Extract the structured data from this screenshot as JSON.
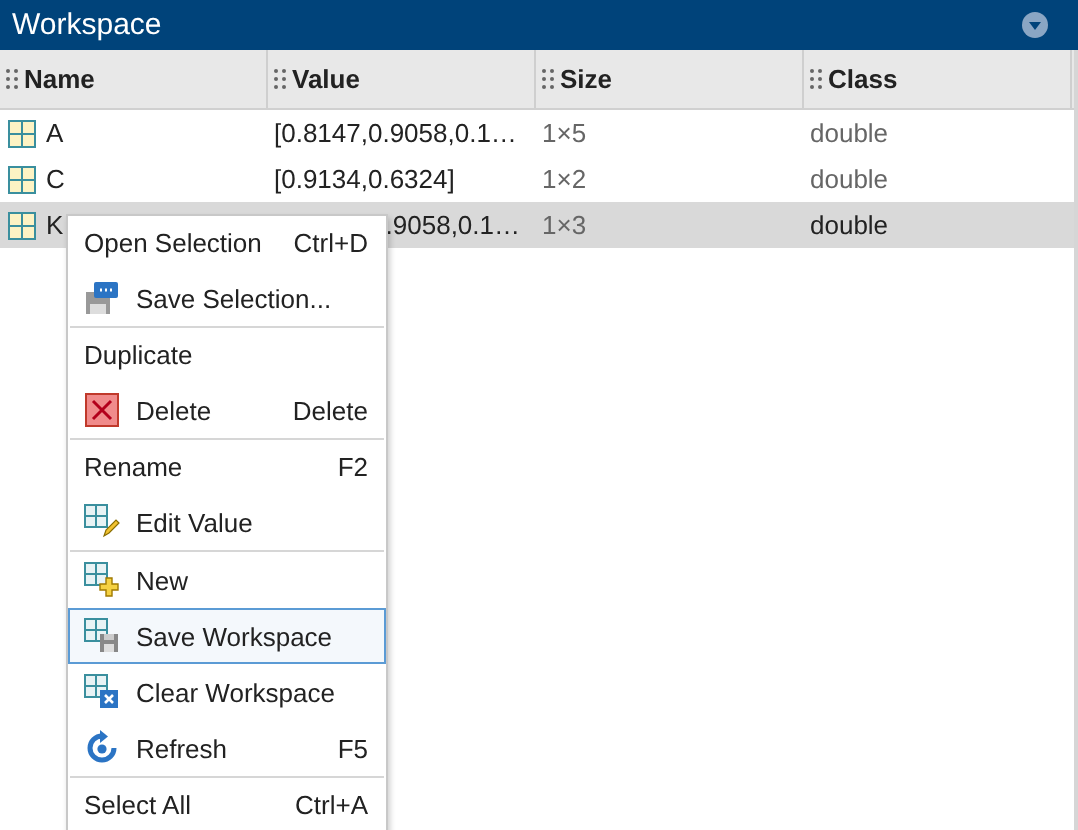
{
  "panel": {
    "title": "Workspace"
  },
  "table": {
    "columns": [
      "Name",
      "Value",
      "Size",
      "Class"
    ],
    "rows": [
      {
        "name": "A",
        "value": "[0.8147,0.9058,0.1…",
        "value_covered": false,
        "size": "1×5",
        "class": "double",
        "selected": false
      },
      {
        "name": "C",
        "value": "[0.9134,0.6324]",
        "value_covered": false,
        "size": "1×2",
        "class": "double",
        "selected": false
      },
      {
        "name": "K",
        "value": ".9058,0.1…",
        "value_covered": true,
        "size": "1×3",
        "class": "double",
        "selected": true
      }
    ]
  },
  "context_menu": {
    "groups": [
      [
        {
          "label": "Open Selection",
          "shortcut": "Ctrl+D",
          "kind": "plain",
          "selected": false
        },
        {
          "label": "Save Selection...",
          "kind": "save-selection",
          "selected": false
        }
      ],
      [
        {
          "label": "Duplicate",
          "kind": "plain",
          "selected": false
        },
        {
          "label": "Delete",
          "shortcut": "Delete",
          "kind": "delete",
          "selected": false
        }
      ],
      [
        {
          "label": "Rename",
          "shortcut": "F2",
          "kind": "plain",
          "selected": false
        },
        {
          "label": "Edit Value",
          "kind": "edit",
          "selected": false
        }
      ],
      [
        {
          "label": "New",
          "kind": "new",
          "selected": false
        },
        {
          "label": "Save Workspace",
          "kind": "save-workspace",
          "selected": true
        },
        {
          "label": "Clear Workspace",
          "kind": "clear",
          "selected": false
        },
        {
          "label": "Refresh",
          "shortcut": "F5",
          "kind": "refresh",
          "selected": false
        }
      ],
      [
        {
          "label": "Select All",
          "shortcut": "Ctrl+A",
          "kind": "plain",
          "selected": false
        }
      ]
    ]
  }
}
